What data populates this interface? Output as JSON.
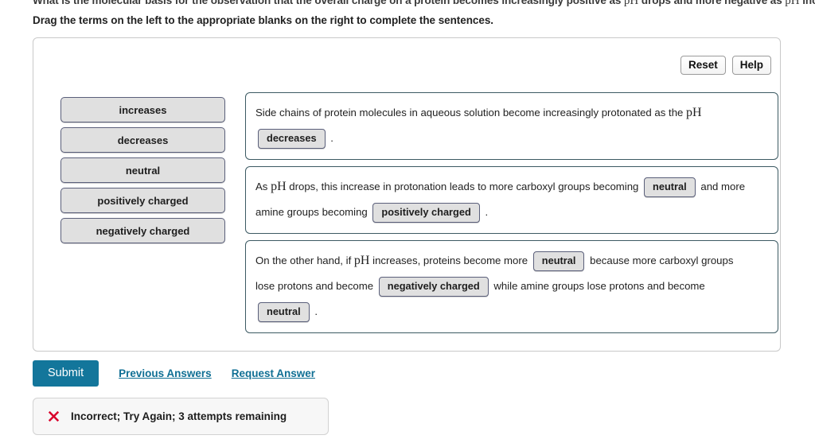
{
  "question": {
    "text_before": "What is the molecular basis for the observation that the overall charge on a protein becomes increasingly positive as ",
    "var1": "pH",
    "text_middle": " drops and more negative as ",
    "var2": "pH",
    "text_after": " inc"
  },
  "instruction": "Drag the terms on the left to the appropriate blanks on the right to complete the sentences.",
  "toolbar": {
    "reset_label": "Reset",
    "help_label": "Help"
  },
  "term_bank": {
    "items": [
      {
        "label": "increases"
      },
      {
        "label": "decreases"
      },
      {
        "label": "neutral"
      },
      {
        "label": "positively charged"
      },
      {
        "label": "negatively charged"
      }
    ]
  },
  "sentences": [
    {
      "parts": [
        {
          "kind": "text",
          "value": "Side chains of protein molecules in aqueous solution become increasingly protonated as the "
        },
        {
          "kind": "math",
          "value": "pH"
        },
        {
          "kind": "break",
          "value": ""
        },
        {
          "kind": "blank",
          "value": "decreases"
        },
        {
          "kind": "text",
          "value": " ."
        }
      ]
    },
    {
      "parts": [
        {
          "kind": "text",
          "value": "As "
        },
        {
          "kind": "math",
          "value": "pH"
        },
        {
          "kind": "text",
          "value": " drops, this increase in protonation leads to more carboxyl groups becoming "
        },
        {
          "kind": "blank",
          "value": "neutral"
        },
        {
          "kind": "text",
          "value": " and more"
        },
        {
          "kind": "break",
          "value": ""
        },
        {
          "kind": "text",
          "value": "amine groups becoming "
        },
        {
          "kind": "blank",
          "value": "positively charged"
        },
        {
          "kind": "text",
          "value": " ."
        }
      ]
    },
    {
      "parts": [
        {
          "kind": "text",
          "value": "On the other hand, if "
        },
        {
          "kind": "math",
          "value": "pH"
        },
        {
          "kind": "text",
          "value": " increases, proteins become more "
        },
        {
          "kind": "blank",
          "value": "neutral"
        },
        {
          "kind": "text",
          "value": " because more carboxyl groups"
        },
        {
          "kind": "break",
          "value": ""
        },
        {
          "kind": "text",
          "value": "lose protons and become "
        },
        {
          "kind": "blank",
          "value": "negatively charged"
        },
        {
          "kind": "text",
          "value": " while amine groups lose protons and become"
        },
        {
          "kind": "break",
          "value": ""
        },
        {
          "kind": "blank",
          "value": "neutral"
        },
        {
          "kind": "text",
          "value": " ."
        }
      ]
    }
  ],
  "actions": {
    "submit_label": "Submit",
    "previous_answers_label": "Previous Answers",
    "request_answer_label": "Request Answer"
  },
  "feedback": {
    "icon": "x-mark-icon",
    "message": "Incorrect; Try Again; 3 attempts remaining",
    "color": "#d9002b"
  }
}
